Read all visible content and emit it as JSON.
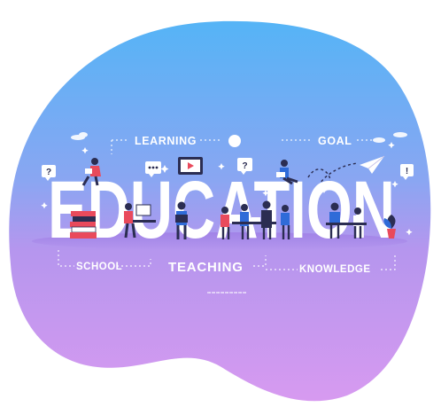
{
  "headline": "EDUCATION",
  "labels": {
    "learning": "LEARNING",
    "goal": "GOAL",
    "school": "SCHOOL",
    "teaching": "TEACHING",
    "knowledge": "KNOWLEDGE"
  },
  "glyphs": {
    "question": "?",
    "exclaim": "!",
    "dots": "•••"
  },
  "colors": {
    "gradient_top": "#5ab5f5",
    "gradient_mid": "#a996ee",
    "gradient_bottom": "#d59af0",
    "letters": "#ffffff",
    "accent_red": "#e94a5c",
    "dark_navy": "#2b2d52",
    "accent_blue": "#2f6bd8"
  },
  "icons": [
    "question-bubble-icon",
    "video-play-icon",
    "chat-bubble-icon",
    "exclamation-bubble-icon",
    "paper-plane-icon",
    "sun-circle-icon",
    "plant-icon",
    "book-stack-icon",
    "laptop-icon"
  ]
}
